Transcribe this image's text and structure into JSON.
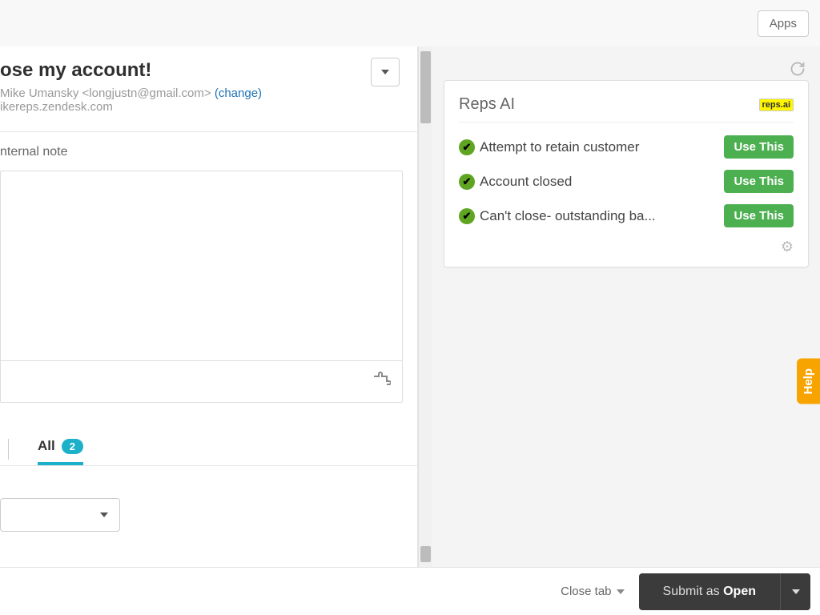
{
  "topbar": {
    "apps": "Apps"
  },
  "ticket": {
    "title": "ose my account!",
    "requester_prefix": " Mike Umansky <longjustn@gmail.com> ",
    "change": "(change)",
    "via": "ikereps.zendesk.com",
    "internal_note_tab": "nternal note"
  },
  "conversation": {
    "all_label": "All",
    "count": "2"
  },
  "apps_panel": {
    "title": "Reps AI",
    "logo_text": "reps.ai",
    "use_label": "Use This",
    "suggestions": [
      {
        "text": "Attempt to retain customer"
      },
      {
        "text": "Account closed"
      },
      {
        "text": "Can't close- outstanding ba..."
      }
    ]
  },
  "help": "Help",
  "footer": {
    "close_tab": "Close tab",
    "submit_prefix": "Submit as ",
    "submit_status": "Open"
  }
}
